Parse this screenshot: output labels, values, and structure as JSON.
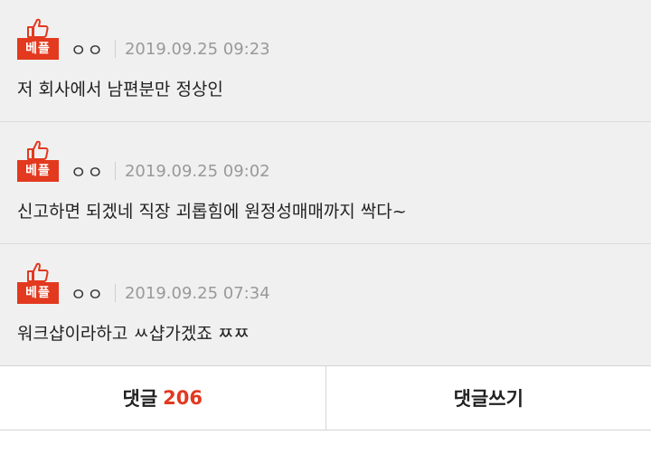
{
  "comments": [
    {
      "badge": "베플",
      "author": "ㅇㅇ",
      "date": "2019.09.25 09:23",
      "text": "저 회사에서 남편분만 정상인"
    },
    {
      "badge": "베플",
      "author": "ㅇㅇ",
      "date": "2019.09.25 09:02",
      "text": "신고하면 되겠네 직장 괴롭힘에 원정성매매까지 싹다~"
    },
    {
      "badge": "베플",
      "author": "ㅇㅇ",
      "date": "2019.09.25 07:34",
      "text": "워크샵이라하고 ㅆ샵가겠죠 ㅉㅉ"
    }
  ],
  "footer": {
    "comments_label": "댓글",
    "comments_count": "206",
    "write_label": "댓글쓰기"
  },
  "colors": {
    "accent": "#e2391f",
    "comment_bg": "#f0f0f0"
  },
  "icons": {
    "badge_icon": "thumbs-up-icon"
  }
}
